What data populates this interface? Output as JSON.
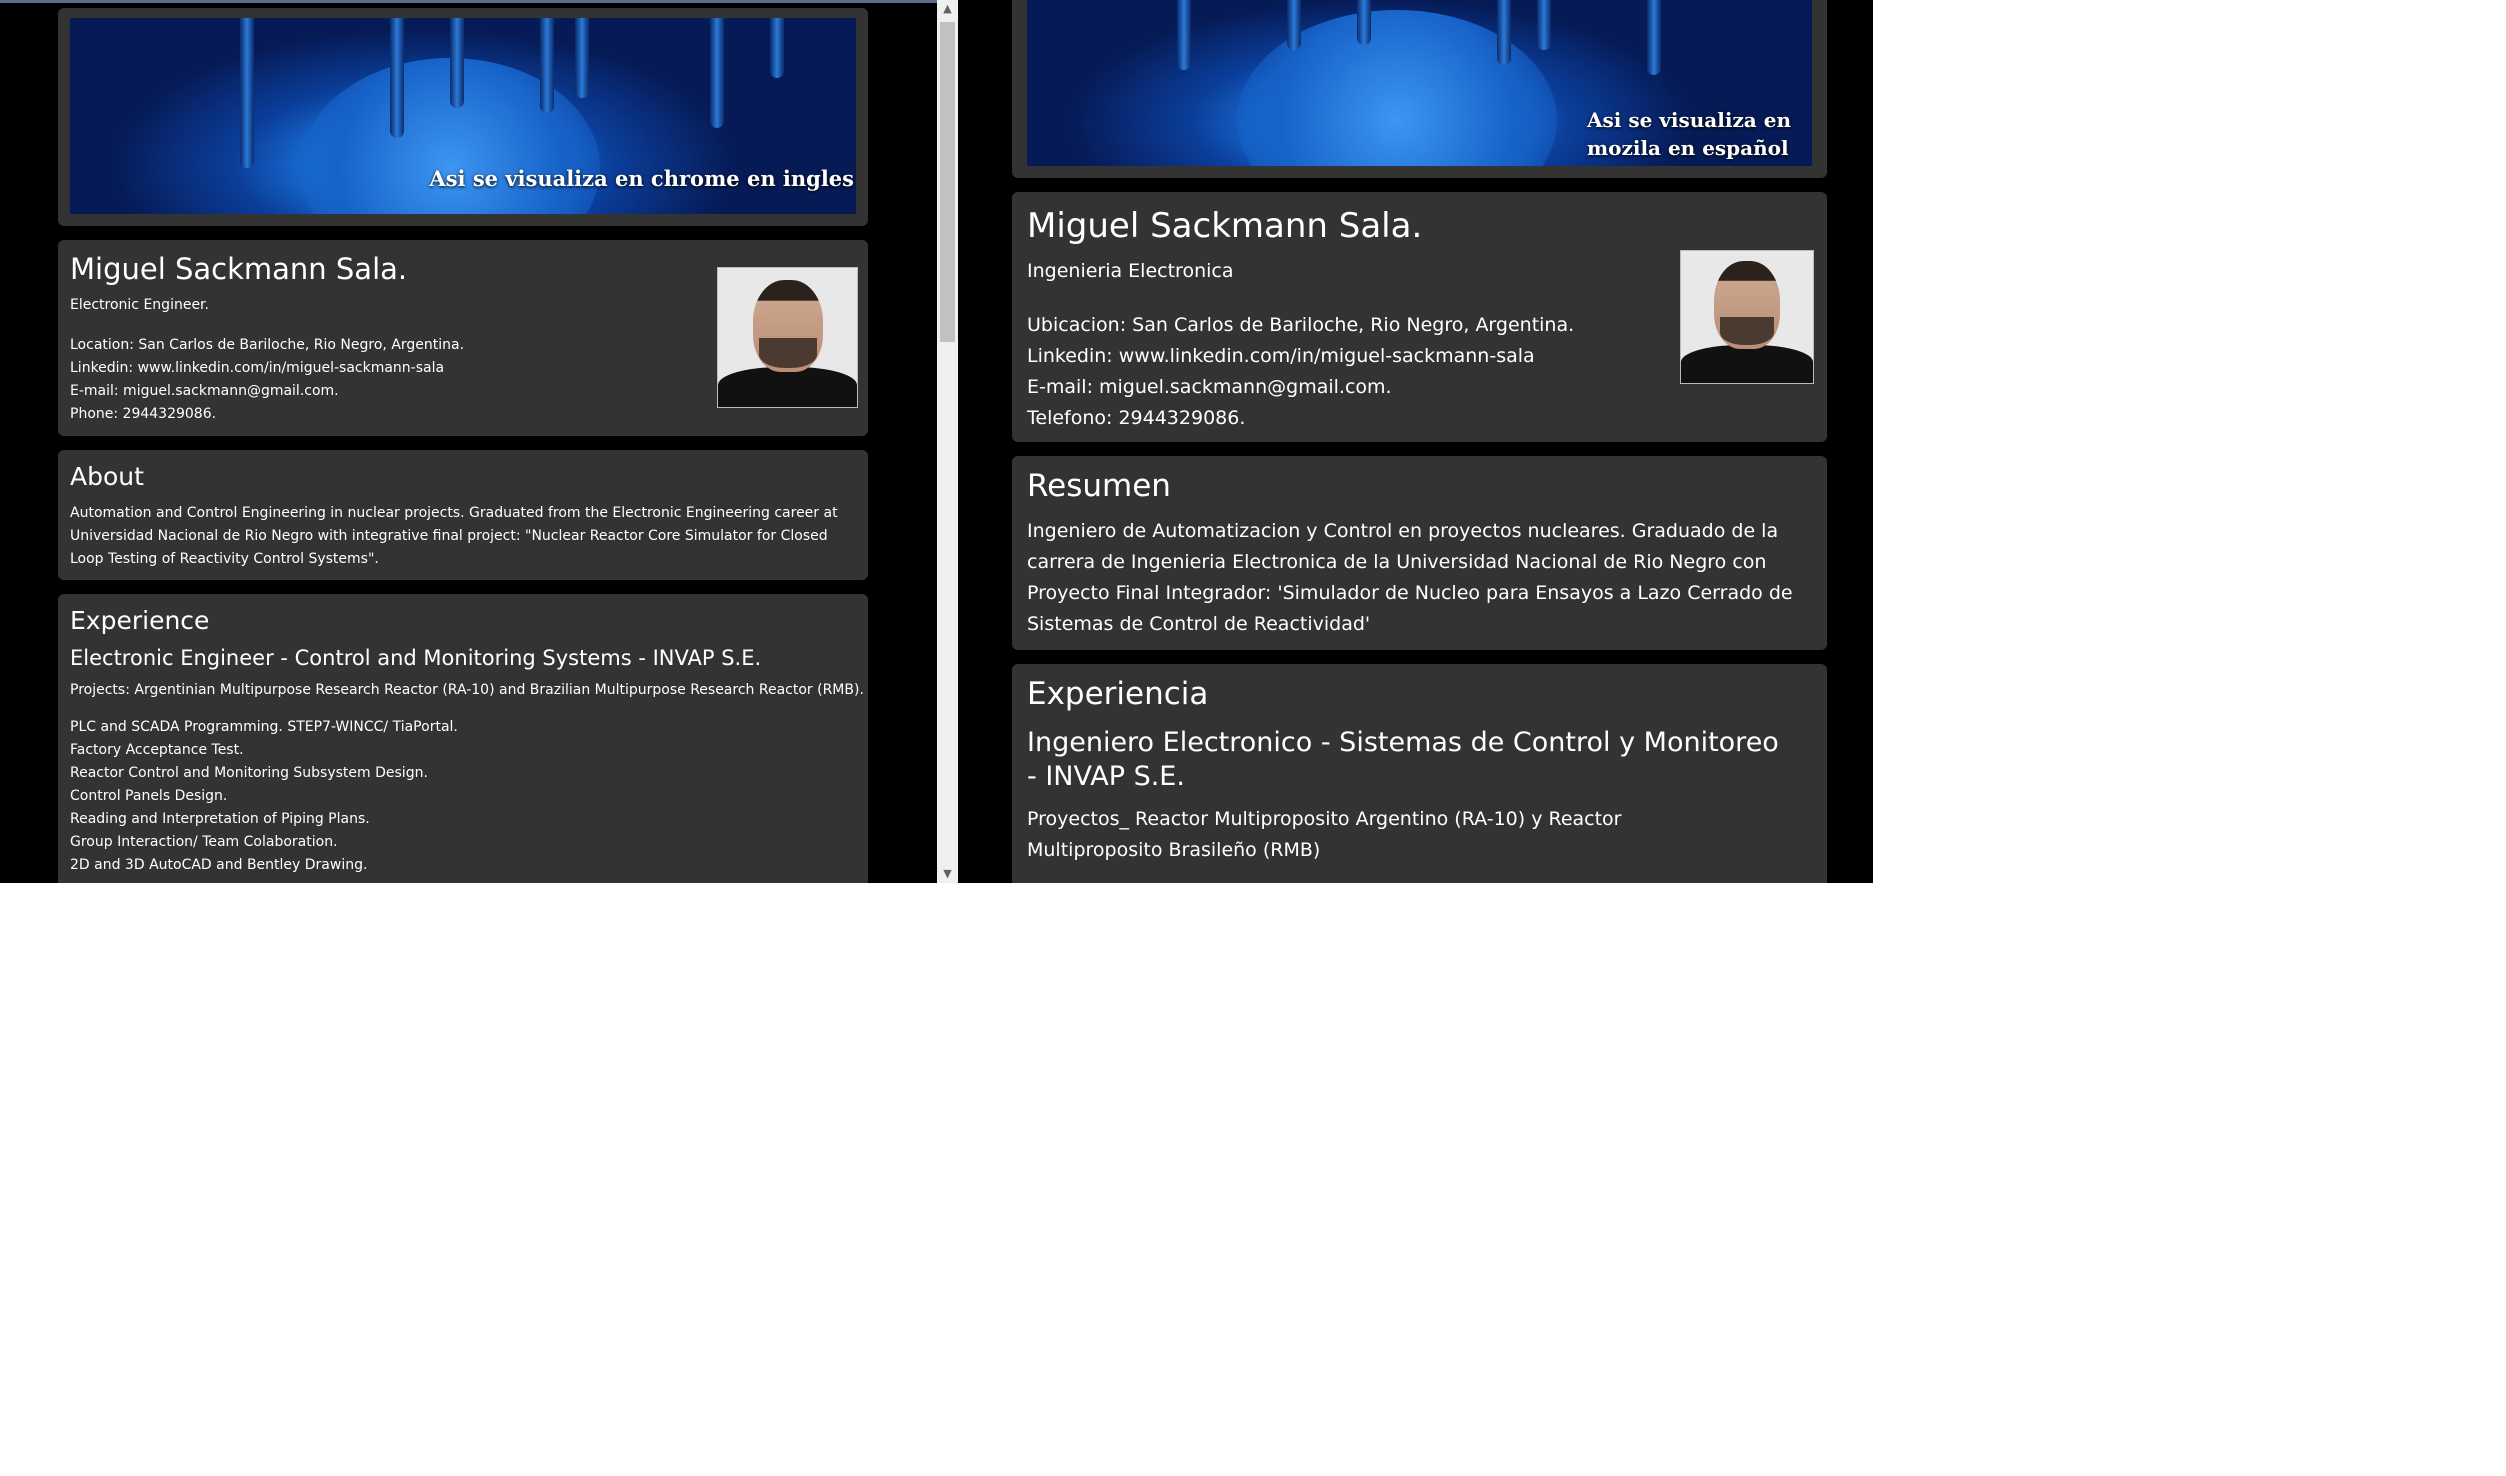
{
  "left": {
    "banner_caption": "Asi se visualiza en chrome en ingles",
    "profile": {
      "name": "Miguel Sackmann Sala.",
      "title": "Electronic Engineer.",
      "location": "Location: San Carlos de Bariloche, Rio Negro, Argentina.",
      "linkedin": "Linkedin: www.linkedin.com/in/miguel-sackmann-sala",
      "email": "E-mail: miguel.sackmann@gmail.com.",
      "phone": "Phone: 2944329086."
    },
    "about": {
      "heading": "About",
      "text": "Automation and Control Engineering in nuclear projects. Graduated from the Electronic Engineering career at Universidad Nacional de Rio Negro with integrative final project: \"Nuclear Reactor Core Simulator for Closed Loop Testing of Reactivity Control Systems\"."
    },
    "experience": {
      "heading": "Experience",
      "job_title": "Electronic Engineer - Control and Monitoring Systems - INVAP S.E.",
      "projects": "Projects: Argentinian Multipurpose Research Reactor (RA-10) and Brazilian Multipurpose Research Reactor (RMB).",
      "tasks": [
        "PLC and SCADA Programming. STEP7-WINCC/ TiaPortal.",
        "Factory Acceptance Test.",
        "Reactor Control and Monitoring Subsystem Design.",
        "Control Panels Design.",
        "Reading and Interpretation of Piping Plans.",
        "Group Interaction/ Team Colaboration.",
        "2D and 3D AutoCAD and Bentley Drawing."
      ]
    }
  },
  "right": {
    "banner_caption_line1": "Asi se visualiza en",
    "banner_caption_line2": "mozila en español",
    "profile": {
      "name": "Miguel Sackmann Sala.",
      "title": "Ingenieria Electronica",
      "location": "Ubicacion: San Carlos de Bariloche, Rio Negro, Argentina.",
      "linkedin": "Linkedin: www.linkedin.com/in/miguel-sackmann-sala",
      "email": "E-mail: miguel.sackmann@gmail.com.",
      "phone": "Telefono: 2944329086."
    },
    "about": {
      "heading": "Resumen",
      "text": "Ingeniero de Automatizacion y Control en proyectos nucleares. Graduado de la carrera de Ingenieria Electronica de la Universidad Nacional de Rio Negro con Proyecto Final Integrador: 'Simulador de Nucleo para Ensayos a Lazo Cerrado de Sistemas de Control de Reactividad'"
    },
    "experience": {
      "heading": "Experiencia",
      "job_title": "Ingeniero Electronico - Sistemas de Control y Monitoreo - INVAP S.E.",
      "projects": "Proyectos_ Reactor Multiproposito Argentino (RA-10) y Reactor Multiproposito Brasileño (RMB)"
    }
  },
  "colors": {
    "card_bg": "#333333",
    "page_bg": "#000000",
    "text": "#ffffff"
  }
}
